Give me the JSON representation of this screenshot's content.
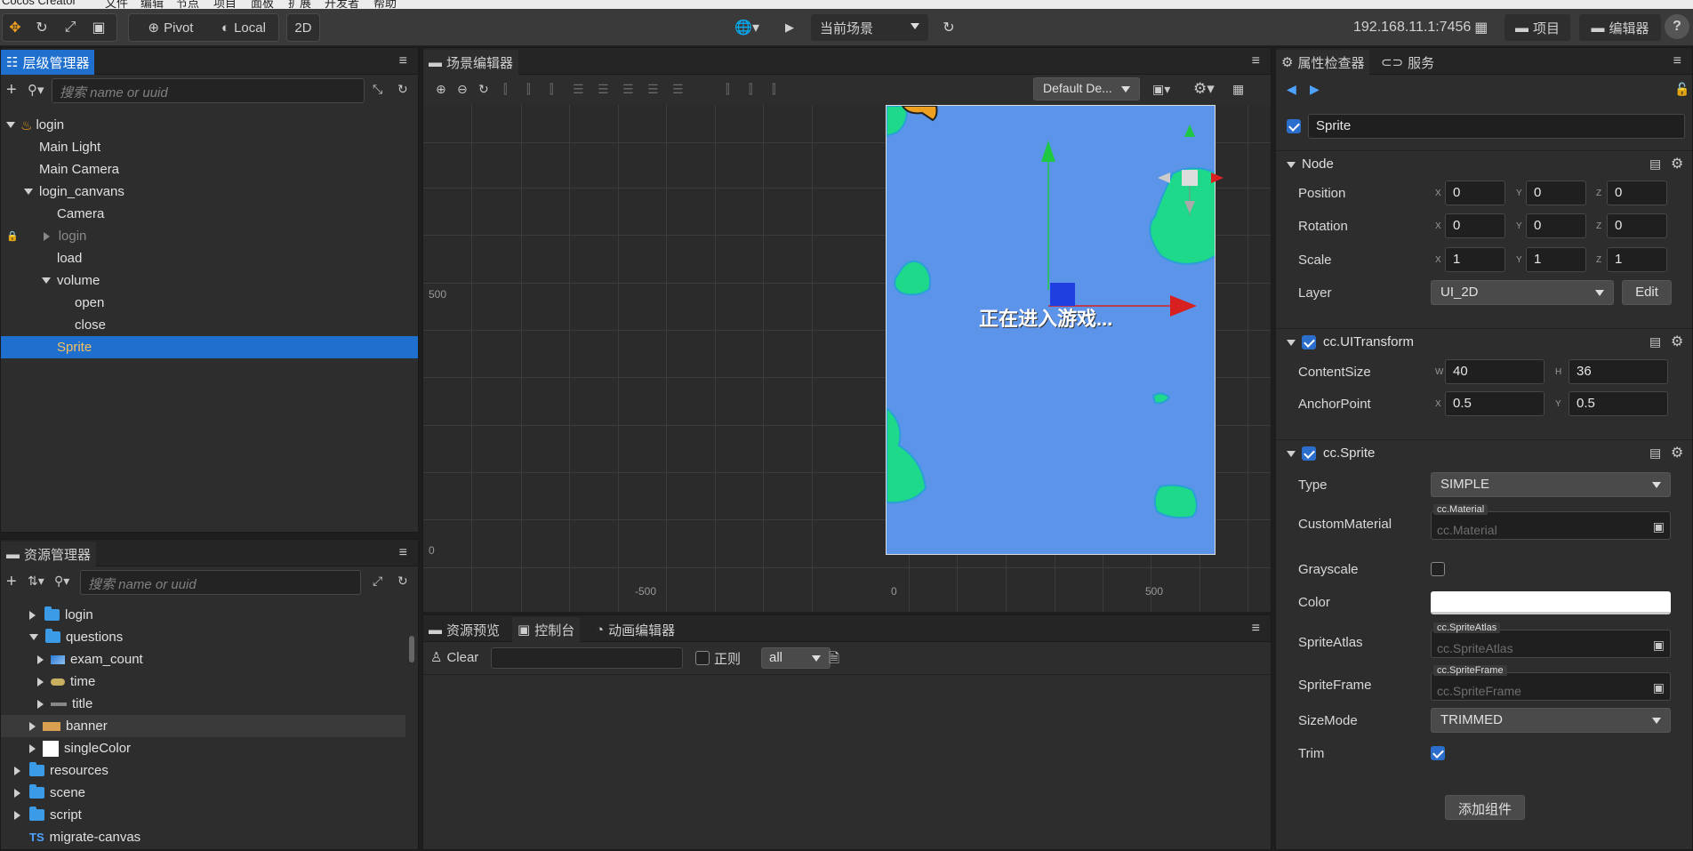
{
  "menubar": {
    "items": [
      "Cocos Creator",
      "文件",
      "编辑",
      "节点",
      "项目",
      "面板",
      "扩展",
      "开发者",
      "帮助"
    ]
  },
  "toolbar": {
    "pivot_label": "Pivot",
    "local_label": "Local",
    "mode_2d_label": "2D",
    "scene_select": "当前场景",
    "ip_label": "192.168.11.1:7456",
    "project_button": "项目",
    "editor_button": "编辑器",
    "help_icon": "?"
  },
  "hierarchy": {
    "tab_label": "层级管理器",
    "search_placeholder": "搜索 name or uuid",
    "items": [
      {
        "label": "login"
      },
      {
        "label": "Main Light"
      },
      {
        "label": "Main Camera"
      },
      {
        "label": "login_canvans"
      },
      {
        "label": "Camera"
      },
      {
        "label": "login"
      },
      {
        "label": "load"
      },
      {
        "label": "volume"
      },
      {
        "label": "open"
      },
      {
        "label": "close"
      },
      {
        "label": "Sprite"
      }
    ]
  },
  "assets": {
    "tab_label": "资源管理器",
    "search_placeholder": "搜索 name or uuid",
    "items": [
      {
        "label": "login"
      },
      {
        "label": "questions"
      },
      {
        "label": "exam_count"
      },
      {
        "label": "time"
      },
      {
        "label": "title"
      },
      {
        "label": "banner"
      },
      {
        "label": "singleColor"
      },
      {
        "label": "resources"
      },
      {
        "label": "scene"
      },
      {
        "label": "script"
      },
      {
        "label": "migrate-canvas"
      }
    ],
    "ts_badge": "TS"
  },
  "scene": {
    "tab_label": "场景编辑器",
    "camera_select": "Default De...",
    "loading_text": "正在进入游戏...",
    "axis_labels": {
      "y500": "500",
      "y0": "0",
      "xneg500": "-500",
      "x0": "0",
      "x500": "500"
    }
  },
  "console": {
    "tabs": [
      "资源预览",
      "控制台",
      "动画编辑器"
    ],
    "clear_label": "Clear",
    "regex_label": "正则",
    "filter_value": "all"
  },
  "inspector": {
    "tabs": [
      "属性检查器",
      "服务"
    ],
    "node_name": "Sprite",
    "node_section": "Node",
    "position": {
      "label": "Position",
      "x": "0",
      "y": "0",
      "z": "0"
    },
    "rotation": {
      "label": "Rotation",
      "x": "0",
      "y": "0",
      "z": "0"
    },
    "scale": {
      "label": "Scale",
      "x": "1",
      "y": "1",
      "z": "1"
    },
    "layer": {
      "label": "Layer",
      "value": "UI_2D",
      "edit": "Edit"
    },
    "uitransform": {
      "title": "cc.UITransform",
      "content_size_label": "ContentSize",
      "w": "40",
      "h": "36",
      "anchor_label": "AnchorPoint",
      "ax": "0.5",
      "ay": "0.5"
    },
    "sprite": {
      "title": "cc.Sprite",
      "type_label": "Type",
      "type_value": "SIMPLE",
      "material_label": "CustomMaterial",
      "material_tag": "cc.Material",
      "material_ph": "cc.Material",
      "grayscale_label": "Grayscale",
      "color_label": "Color",
      "atlas_label": "SpriteAtlas",
      "atlas_tag": "cc.SpriteAtlas",
      "atlas_ph": "cc.SpriteAtlas",
      "frame_label": "SpriteFrame",
      "frame_tag": "cc.SpriteFrame",
      "frame_ph": "cc.SpriteFrame",
      "sizemode_label": "SizeMode",
      "sizemode_value": "TRIMMED",
      "trim_label": "Trim"
    },
    "add_component": "添加组件",
    "axis": {
      "x": "X",
      "y": "Y",
      "z": "Z",
      "w": "W",
      "h": "H"
    }
  },
  "colors": {
    "accent": "#1f6fcf",
    "scene_bg": "#5b94e8",
    "island": "#1ed98a"
  }
}
